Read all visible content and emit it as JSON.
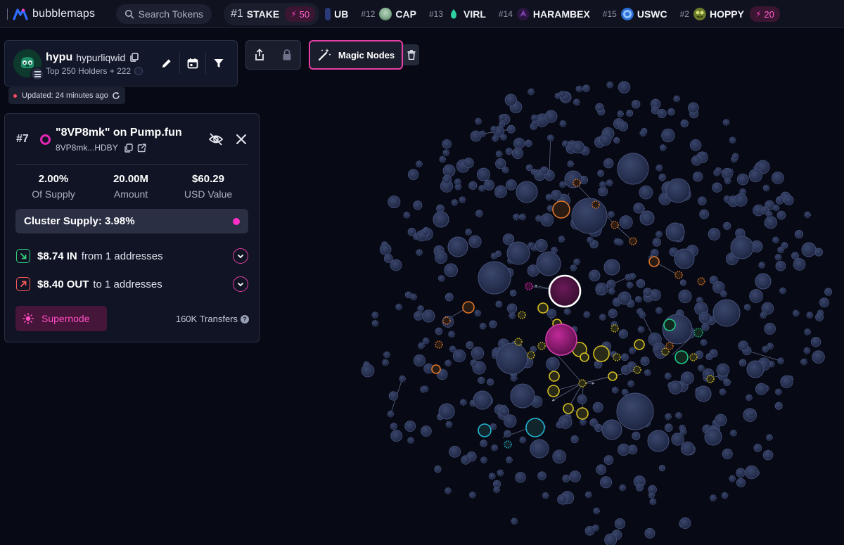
{
  "app": {
    "brand": "bubblemaps",
    "search_placeholder": "Search Tokens"
  },
  "ticker": [
    {
      "rank": "#1",
      "symbol": "STAKE",
      "logo_color": "#e9ecf5",
      "boost": "50",
      "highlight": true
    },
    {
      "rank": "",
      "symbol": "UB",
      "logo_color": "#2a3a7a",
      "boost": null
    },
    {
      "rank": "#12",
      "symbol": "CAP",
      "logo_color": "#7fa88a",
      "boost": null
    },
    {
      "rank": "#13",
      "symbol": "VIRL",
      "logo_color": "#2fd2a1",
      "boost": null
    },
    {
      "rank": "#14",
      "symbol": "HARAMBEX",
      "logo_color": "#5a2d7a",
      "boost": null
    },
    {
      "rank": "#15",
      "symbol": "USWC",
      "logo_color": "#2b6fd6",
      "boost": null
    },
    {
      "rank": "#2",
      "symbol": "HOPPY",
      "logo_color": "#8a9a3a",
      "boost": "20"
    }
  ],
  "token": {
    "symbol": "hypu",
    "name": "hypurliqwid",
    "subtitle": "Top 250 Holders + 222",
    "avatar_color": "#0d3a2c"
  },
  "updated": "Updated: 24 minutes ago",
  "toolbar": {
    "magic_nodes": "Magic Nodes"
  },
  "wallet": {
    "rank": "#7",
    "title": "\"8VP8mk\" on Pump.fun",
    "address": "8VP8mk...HDBY",
    "stats": [
      {
        "value": "2.00%",
        "label": "Of Supply"
      },
      {
        "value": "20.00M",
        "label": "Amount"
      },
      {
        "value": "$60.29",
        "label": "USD Value"
      }
    ],
    "cluster_supply": "Cluster Supply: 3.98%",
    "flow_in": {
      "amount": "$8.74 IN",
      "desc": "from 1 addresses"
    },
    "flow_out": {
      "amount": "$8.40 OUT",
      "desc": "to 1 addresses"
    },
    "supernode": "Supernode",
    "transfers": "160K Transfers",
    "accent": "#e426b4"
  },
  "colors": {
    "bubble": "#26304f",
    "bubble_edge": "#46517a",
    "selected": "#4a1240",
    "purple_cluster": "#9a1a7a",
    "yellow": "#d8c020",
    "orange": "#e0762a",
    "green": "#22c98a",
    "cyan": "#22b6d2"
  }
}
